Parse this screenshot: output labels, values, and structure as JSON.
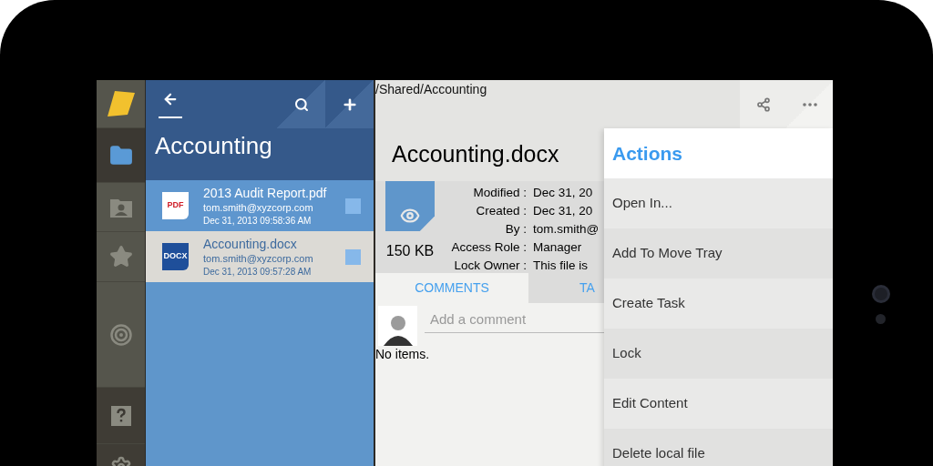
{
  "rail": {
    "items": [
      {
        "kind": "logo",
        "selected": false
      },
      {
        "kind": "folder",
        "selected": true
      },
      {
        "kind": "contacts",
        "selected": false
      },
      {
        "kind": "star",
        "selected": false
      },
      {
        "kind": "target",
        "selected": false
      }
    ],
    "footer": [
      {
        "kind": "help",
        "selected": false
      },
      {
        "kind": "settings",
        "selected": false
      }
    ]
  },
  "file_list": {
    "title": "Accounting",
    "files": [
      {
        "name": "2013 Audit Report.pdf",
        "kind": "pdf",
        "badge": "PDF",
        "owner": "tom.smith@xyzcorp.com",
        "date": "Dec 31, 2013 09:58:36 AM",
        "selected": false,
        "checked": false
      },
      {
        "name": "Accounting.docx",
        "kind": "docx",
        "badge": "DOCX",
        "owner": "tom.smith@xyzcorp.com",
        "date": "Dec 31, 2013 09:57:28 AM",
        "selected": true,
        "checked": false
      }
    ]
  },
  "detail": {
    "path": "/Shared/Accounting",
    "title": "Accounting.docx",
    "size": "150 KB",
    "properties": [
      {
        "label": "Modified :",
        "value": "Dec 31, 20"
      },
      {
        "label": "Created :",
        "value": "Dec 31, 20"
      },
      {
        "label": "By :",
        "value": "tom.smith@"
      },
      {
        "label": "Access Role :",
        "value": "Manager"
      },
      {
        "label": "Lock Owner :",
        "value": "This file is"
      }
    ],
    "tabs": [
      {
        "label": "COMMENTS",
        "selected": true
      },
      {
        "label": "TA",
        "selected": false
      }
    ],
    "comment": {
      "placeholder": "Add a comment"
    },
    "empty_text": "No items."
  },
  "actions_menu": {
    "title": "Actions",
    "items": [
      "Open In...",
      "Add To Move Tray",
      "Create Task",
      "Lock",
      "Edit Content",
      "Delete local file"
    ]
  }
}
